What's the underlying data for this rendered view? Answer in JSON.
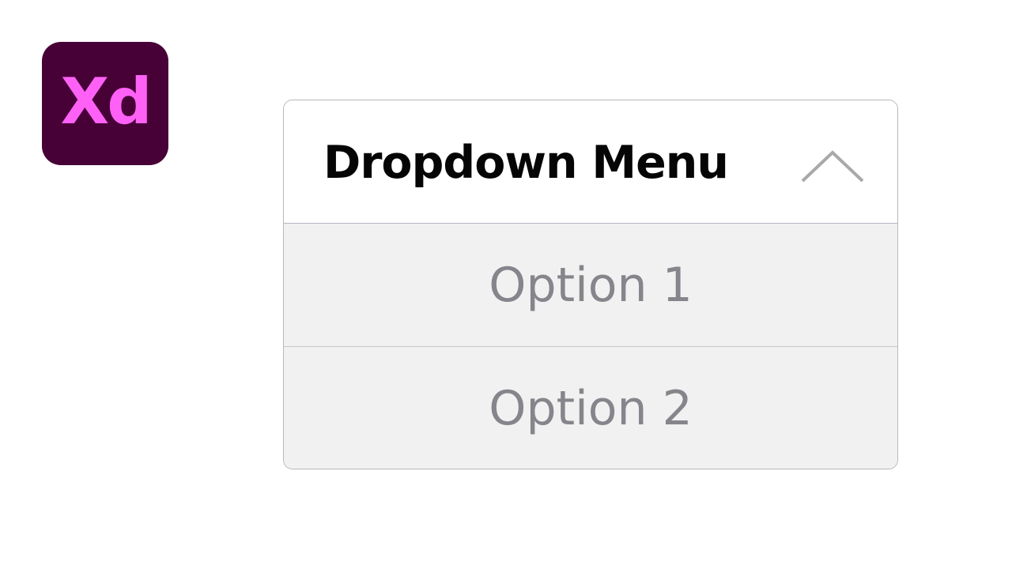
{
  "logo": {
    "text": "Xd",
    "background_color": "#470137",
    "text_color": "#ff61f6"
  },
  "dropdown": {
    "title": "Dropdown Menu",
    "toggle_icon": "chevron-up-icon",
    "options": [
      {
        "label": "Option 1"
      },
      {
        "label": "Option 2"
      }
    ]
  }
}
